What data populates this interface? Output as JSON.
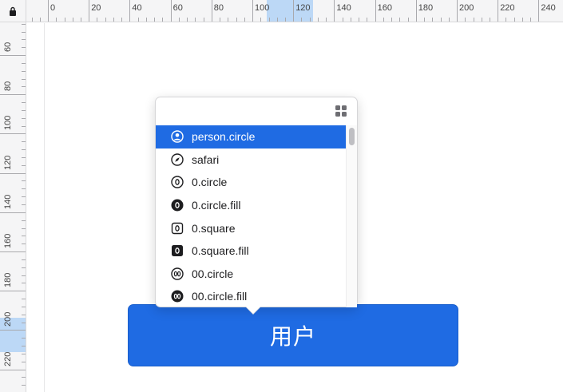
{
  "ruler": {
    "top_labels": [
      "0",
      "20",
      "40",
      "60",
      "80",
      "100",
      "120",
      "140",
      "160",
      "180",
      "200",
      "220",
      "240"
    ],
    "left_labels": [
      "60",
      "80",
      "100",
      "120",
      "140",
      "160",
      "180",
      "200",
      "220"
    ]
  },
  "popover": {
    "items": [
      {
        "label": "person.circle",
        "icon": "person-circle-icon",
        "selected": true
      },
      {
        "label": "safari",
        "icon": "safari-compass-icon",
        "selected": false
      },
      {
        "label": "0.circle",
        "icon": "zero-circle-icon",
        "selected": false
      },
      {
        "label": "0.circle.fill",
        "icon": "zero-circle-fill-icon",
        "selected": false
      },
      {
        "label": "0.square",
        "icon": "zero-square-icon",
        "selected": false
      },
      {
        "label": "0.square.fill",
        "icon": "zero-square-fill-icon",
        "selected": false
      },
      {
        "label": "00.circle",
        "icon": "double-zero-circle-icon",
        "selected": false
      },
      {
        "label": "00.circle.fill",
        "icon": "double-zero-circle-fill-icon",
        "selected": false
      }
    ]
  },
  "button": {
    "label": "用户"
  },
  "colors": {
    "accent": "#1f6be3",
    "ruler_highlight": "#bcd8f6"
  }
}
